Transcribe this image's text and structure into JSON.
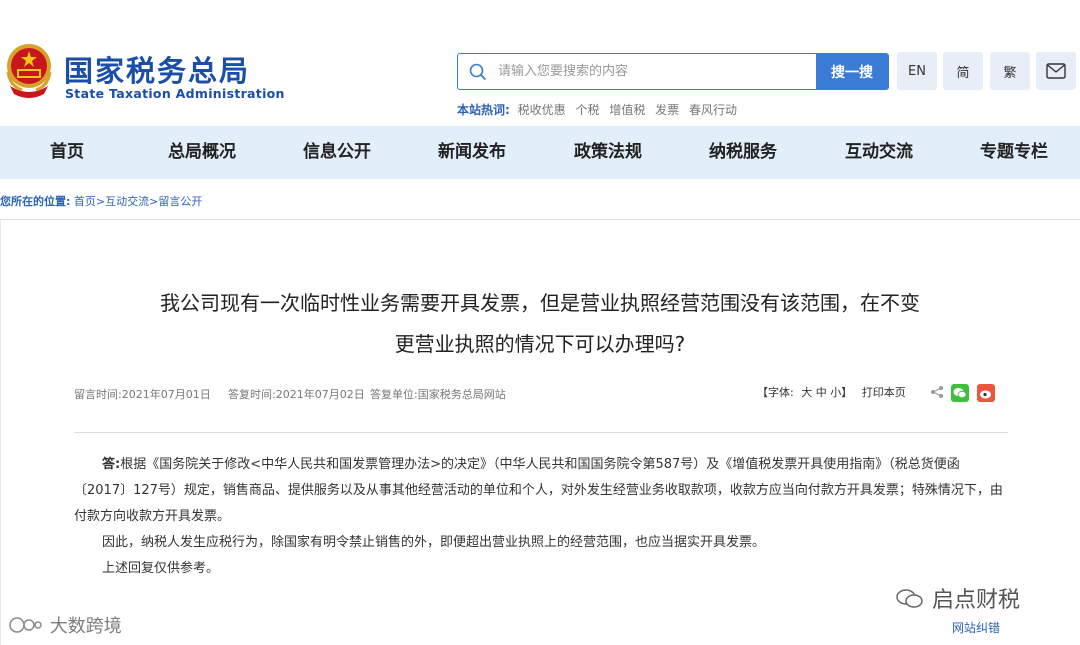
{
  "header": {
    "logo_cn": "国家税务总局",
    "logo_en": "State Taxation Administration",
    "search": {
      "placeholder": "请输入您要搜索的内容",
      "button": "搜一搜"
    },
    "hotwords": {
      "title": "本站热词:",
      "items": [
        "税收优惠",
        "个税",
        "增值税",
        "发票",
        "春风行动"
      ]
    },
    "tools": {
      "en": "EN",
      "simplified": "简",
      "traditional": "繁",
      "mail_icon": "mail-icon"
    }
  },
  "nav": [
    "首页",
    "总局概况",
    "信息公开",
    "新闻发布",
    "政策法规",
    "纳税服务",
    "互动交流",
    "专题专栏"
  ],
  "breadcrumb": {
    "label": "您所在的位置:",
    "items": [
      "首页",
      "互动交流",
      "留言公开"
    ]
  },
  "article": {
    "title_line1": "我公司现有一次临时性业务需要开具发票，但是营业执照经营范围没有该范围，在不变",
    "title_line2": "更营业执照的情况下可以办理吗?",
    "meta": {
      "msg_time": "留言时间:2021年07月01日",
      "reply_time": "答复时间:2021年07月02日",
      "reply_unit": "答复单位:国家税务总局网站",
      "font_label": "【字体:",
      "font_big": "大",
      "font_mid": "中",
      "font_small": "小】",
      "print": "打印本页"
    },
    "answer_label": "答:",
    "answer_p1": "根据《国务院关于修改<中华人民共和国发票管理办法>的决定》（中华人民共和国国务院令第587号）及《增值税发票开具使用指南》（税总货便函〔2017〕127号）规定，销售商品、提供服务以及从事其他经营活动的单位和个人，对外发生经营业务收取款项，收款方应当向付款方开具发票；特殊情况下，由付款方向收款方开具发票。",
    "answer_p2": "因此，纳税人发生应税行为，除国家有明令禁止销售的外，即便超出营业执照上的经营范围，也应当据实开具发票。",
    "answer_p3": "上述回复仅供参考。"
  },
  "footer": {
    "error_link": "网站纠错",
    "watermark_right": "启点财税",
    "watermark_left": "大数跨境"
  },
  "colors": {
    "brand_blue": "#1a4ea8",
    "accent_blue": "#3a7bd5",
    "nav_bg": "#e3eefb"
  }
}
